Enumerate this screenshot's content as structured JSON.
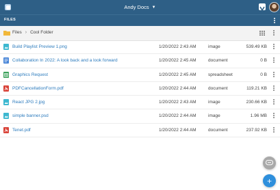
{
  "app": {
    "title": "Andy Docs"
  },
  "subheader": {
    "label": "FILES"
  },
  "breadcrumb": {
    "root": "Files",
    "current": "Cool Folder"
  },
  "files": [
    {
      "name": "Build Playlist Preview 1.png",
      "date": "1/20/2022 2:43 AM",
      "type": "image",
      "size": "539.49 KB",
      "icon": "image-file-icon"
    },
    {
      "name": "Collaboration In 2022: A look back and a look forward",
      "date": "1/20/2022 2:45 AM",
      "type": "document",
      "size": "0 B",
      "icon": "document-file-icon"
    },
    {
      "name": "Graphics Request",
      "date": "1/20/2022 2:45 AM",
      "type": "spreadsheet",
      "size": "0 B",
      "icon": "spreadsheet-file-icon"
    },
    {
      "name": "PDFCancellationForm.pdf",
      "date": "1/20/2022 2:44 AM",
      "type": "document",
      "size": "119.21 KB",
      "icon": "pdf-file-icon"
    },
    {
      "name": "React JPG 2.jpg",
      "date": "1/20/2022 2:43 AM",
      "type": "image",
      "size": "230.66 KB",
      "icon": "image-file-icon"
    },
    {
      "name": "simple banner.psd",
      "date": "1/20/2022 2:44 AM",
      "type": "image",
      "size": "1.96 MB",
      "icon": "image-file-icon"
    },
    {
      "name": "Tenet.pdf",
      "date": "1/20/2022 2:44 AM",
      "type": "document",
      "size": "237.92 KB",
      "icon": "pdf-file-icon"
    }
  ],
  "colors": {
    "header": "#2e5f86",
    "link": "#2c7bbd",
    "fab": "#2e8fdc",
    "pdf": "#d9453b",
    "spreadsheet": "#3aa05a",
    "image": "#3db8d0",
    "doc": "#4a86d8"
  }
}
